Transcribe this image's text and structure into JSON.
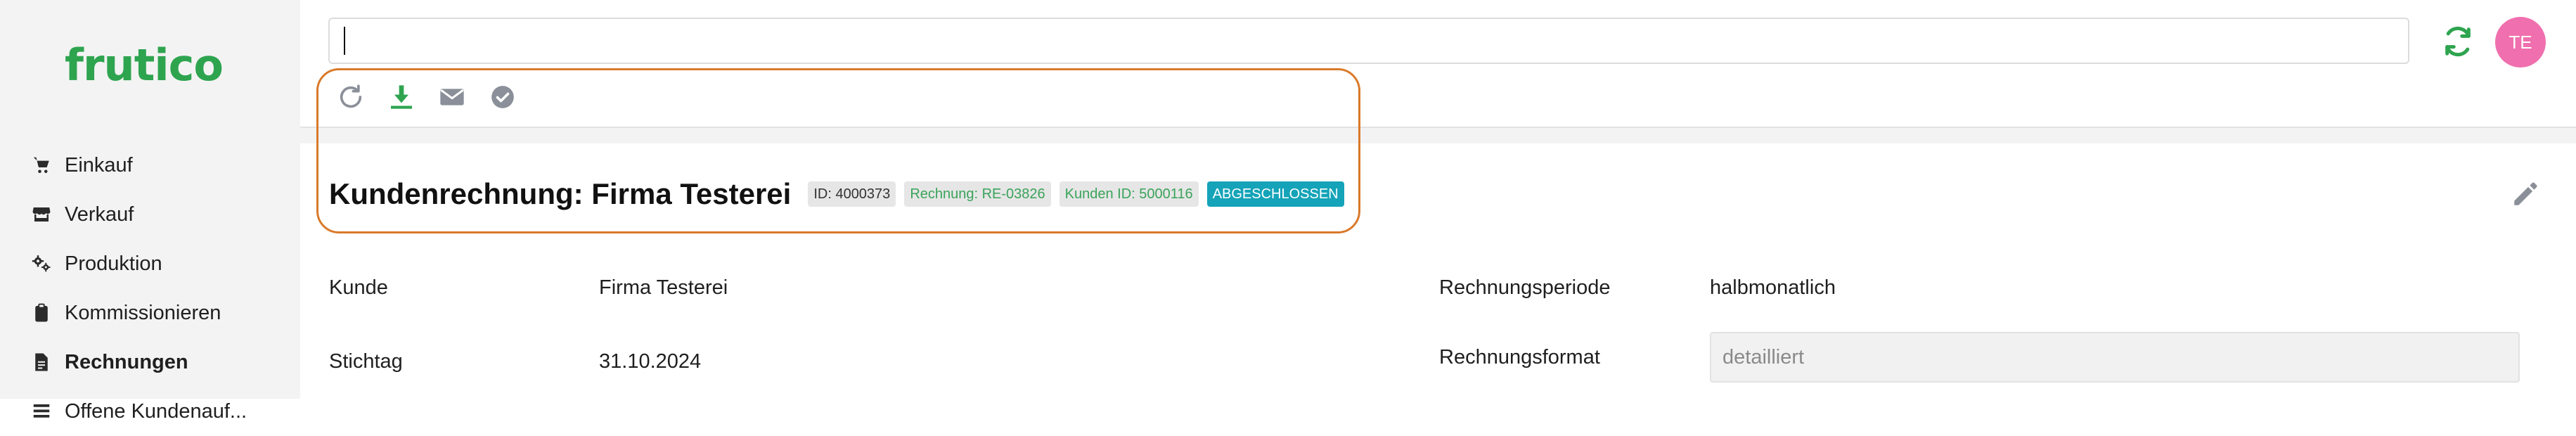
{
  "app": {
    "logo_text": "frutico"
  },
  "sidebar": {
    "items": [
      {
        "label": "Einkauf",
        "icon": "cart-icon",
        "active": false
      },
      {
        "label": "Verkauf",
        "icon": "store-icon",
        "active": false
      },
      {
        "label": "Produktion",
        "icon": "gears-icon",
        "active": false
      },
      {
        "label": "Kommissionieren",
        "icon": "clipboard-icon",
        "active": false
      },
      {
        "label": "Rechnungen",
        "icon": "document-icon",
        "active": true
      },
      {
        "label": "Offene Kundenauf...",
        "icon": "list-icon",
        "active": false
      }
    ]
  },
  "header": {
    "search": {
      "value": "",
      "placeholder": ""
    },
    "sync_icon": "sync-icon",
    "user_initials": "TE",
    "colors": {
      "brand": "#2ea44f",
      "avatar": "#f06fae",
      "highlight": "#d97a2b",
      "status": "#14a3b8"
    }
  },
  "toolbar": {
    "actions": [
      "refresh-icon",
      "download-icon",
      "mail-icon",
      "check-circle-icon"
    ]
  },
  "document": {
    "title": "Kundenrechnung: Firma Testerei",
    "badges": {
      "id": "ID: 4000373",
      "invoice": "Rechnung: RE-03826",
      "customer_id": "Kunden ID: 5000116",
      "status": "ABGESCHLOSSEN"
    },
    "fields": {
      "kunde_label": "Kunde",
      "kunde_value": "Firma Testerei",
      "stichtag_label": "Stichtag",
      "stichtag_value": "31.10.2024",
      "periode_label": "Rechnungsperiode",
      "periode_value": "halbmonatlich",
      "format_label": "Rechnungsformat",
      "format_value": "detailliert"
    }
  }
}
